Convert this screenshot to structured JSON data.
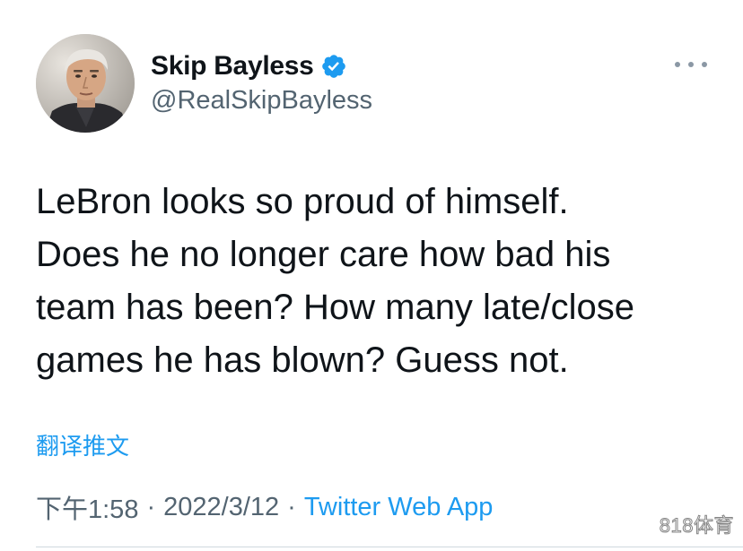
{
  "author": {
    "display_name": "Skip Bayless",
    "handle": "@RealSkipBayless",
    "verified": true
  },
  "tweet": {
    "text": "LeBron looks so proud of himself.\nDoes he no longer care how bad his\nteam has been? How many late/close\ngames he has blown? Guess not.",
    "translate_label": "翻译推文"
  },
  "meta": {
    "time": "下午1:58",
    "separator": "·",
    "date": "2022/3/12",
    "source": "Twitter Web App"
  },
  "watermark": "818体育",
  "colors": {
    "accent": "#1d9bf0",
    "secondary_text": "#536471",
    "primary_text": "#0f1419"
  },
  "icons": {
    "verified": "verified-badge-icon",
    "more": "more-options-icon"
  }
}
